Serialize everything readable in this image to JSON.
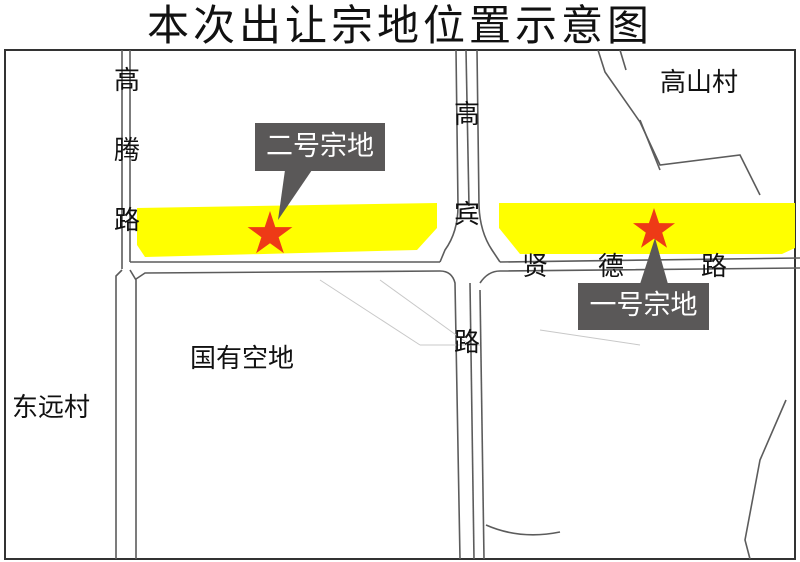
{
  "title": "本次出让宗地位置示意图",
  "villages": {
    "gaoshan": "高山村",
    "dongyuan": "东远村"
  },
  "roads": {
    "gaoteng": [
      "高",
      "腾",
      "路"
    ],
    "gaobin": [
      "高",
      "宾",
      "路"
    ],
    "xiande": [
      "贤",
      "德",
      "路"
    ]
  },
  "areas": {
    "vacant": "国有空地"
  },
  "parcels": {
    "no1": "一号宗地",
    "no2": "二号宗地"
  },
  "colors": {
    "parcel_fill": "#ffff00",
    "marker": "#ee3a16",
    "callout": "#5a5858",
    "road_line": "#5c5c5c"
  }
}
